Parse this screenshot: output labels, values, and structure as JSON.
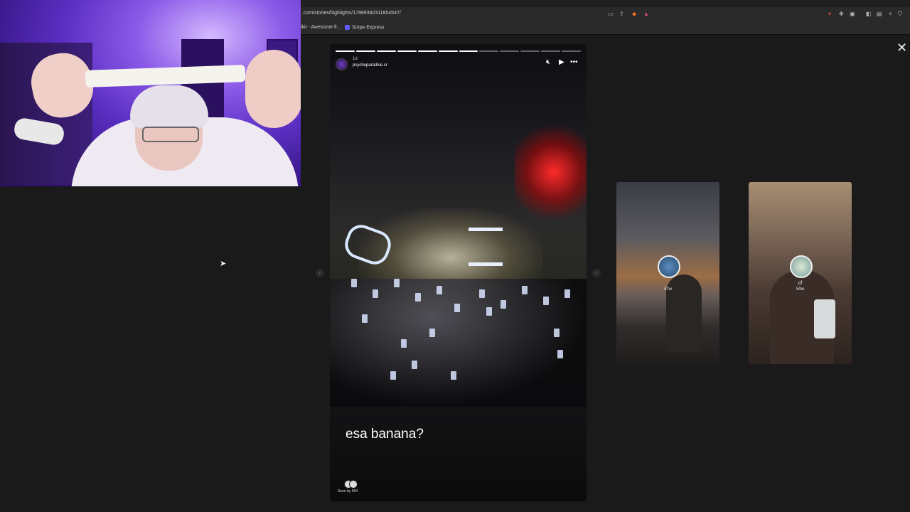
{
  "browser": {
    "url": ".com/stories/highlights/17989392311854547/",
    "bookmarks": [
      {
        "label": "ikit - Awesome fr...",
        "color": "#ffffff"
      },
      {
        "label": "Stripe Express",
        "color": "#635bff"
      }
    ]
  },
  "story": {
    "time_ago": "1d",
    "username": "psychoparadise.cr",
    "segments_total": 12,
    "segments_done": 7,
    "caption": "esa banana?",
    "seen_by": "Seen by 594",
    "controls": {
      "mute_icon": "speaker-muted-icon",
      "play_icon": "play-icon",
      "more_icon": "more-icon"
    }
  },
  "close_icon": "close-icon",
  "side_stories": [
    {
      "name": "",
      "time": "47w"
    },
    {
      "name": "cf",
      "time": "50w"
    }
  ],
  "colors": {
    "background": "#1a1a1a",
    "accent_red": "#ff2a2a",
    "webcam_purple": "#8b5ae8"
  }
}
